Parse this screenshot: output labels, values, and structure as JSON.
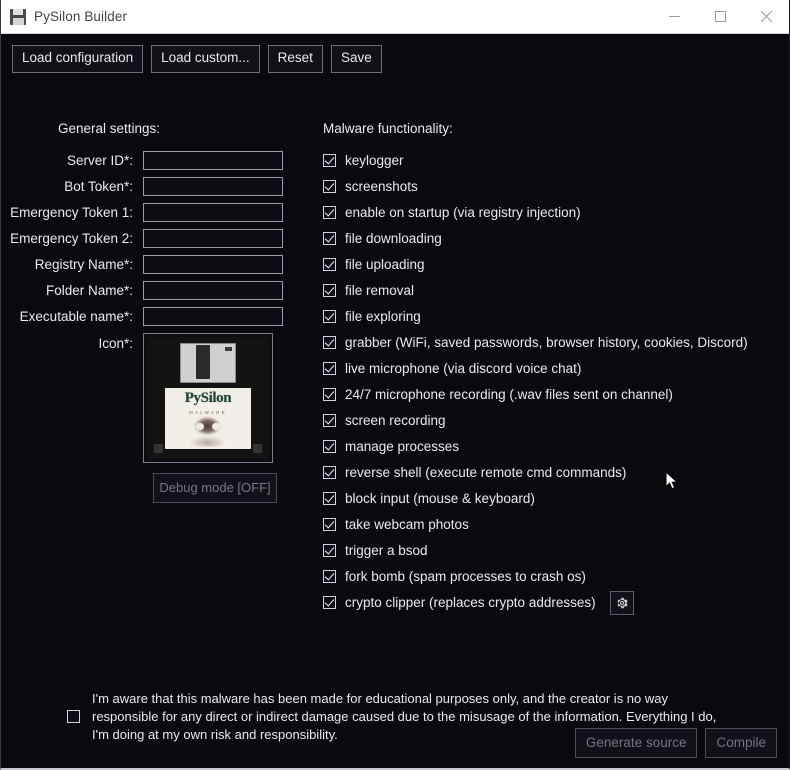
{
  "window": {
    "title": "PySilon Builder",
    "icon": "floppy-disk-icon",
    "minimize": "minimize-icon",
    "maximize": "maximize-icon",
    "close": "close-icon"
  },
  "toolbar": {
    "buttons": [
      {
        "label": "Load configuration"
      },
      {
        "label": "Load custom..."
      },
      {
        "label": "Reset"
      },
      {
        "label": "Save"
      }
    ]
  },
  "general_settings": {
    "heading": "General settings:",
    "fields": [
      {
        "label": "Server ID*:",
        "value": "",
        "placeholder": ""
      },
      {
        "label": "Bot Token*:",
        "value": "",
        "placeholder": ""
      },
      {
        "label": "Emergency Token 1:",
        "value": "",
        "placeholder": ""
      },
      {
        "label": "Emergency Token 2:",
        "value": "",
        "placeholder": ""
      },
      {
        "label": "Registry Name*:",
        "value": "",
        "placeholder": ""
      },
      {
        "label": "Folder Name*:",
        "value": "",
        "placeholder": ""
      },
      {
        "label": "Executable name*:",
        "value": "",
        "placeholder": ""
      }
    ],
    "icon_label": "Icon*:",
    "icon_preview": {
      "brand": "PySilon",
      "subtitle": "MALWARE",
      "type": "floppy-disk-with-skull"
    },
    "debug_button": "Debug mode [OFF]"
  },
  "functionality": {
    "heading": "Malware functionality:",
    "items": [
      {
        "label": "keylogger",
        "checked": true
      },
      {
        "label": "screenshots",
        "checked": true
      },
      {
        "label": "enable on startup (via registry injection)",
        "checked": true
      },
      {
        "label": "file downloading",
        "checked": true
      },
      {
        "label": "file uploading",
        "checked": true
      },
      {
        "label": "file removal",
        "checked": true
      },
      {
        "label": "file exploring",
        "checked": true
      },
      {
        "label": "grabber (WiFi, saved passwords, browser history, cookies, Discord)",
        "checked": true
      },
      {
        "label": "live microphone (via discord voice chat)",
        "checked": true
      },
      {
        "label": "24/7 microphone recording (.wav files sent on channel)",
        "checked": true
      },
      {
        "label": "screen recording",
        "checked": true
      },
      {
        "label": "manage processes",
        "checked": true
      },
      {
        "label": "reverse shell (execute remote cmd commands)",
        "checked": true
      },
      {
        "label": "block input (mouse & keyboard)",
        "checked": true
      },
      {
        "label": "take webcam photos",
        "checked": true
      },
      {
        "label": "trigger a bsod",
        "checked": true
      },
      {
        "label": "fork bomb (spam processes to crash os)",
        "checked": true
      },
      {
        "label": "crypto clipper (replaces crypto addresses)",
        "checked": true,
        "settings_icon": "gear-icon"
      }
    ]
  },
  "disclaimer": {
    "checked": false,
    "text": "I'm aware that this malware has been made for educational purposes only, and the creator is no way responsible for any direct or indirect damage caused due to the misusage of the information. Everything I do, I'm doing at my own risk and responsibility."
  },
  "footer": {
    "generate_source": "Generate source",
    "compile": "Compile"
  },
  "colors": {
    "background": "#0a0a0e",
    "titlebar": "#ffffff",
    "text": "#e9e9ef",
    "disabled_text": "#74747d",
    "border": "#6e6e7a",
    "brand_green": "#1d4431"
  }
}
